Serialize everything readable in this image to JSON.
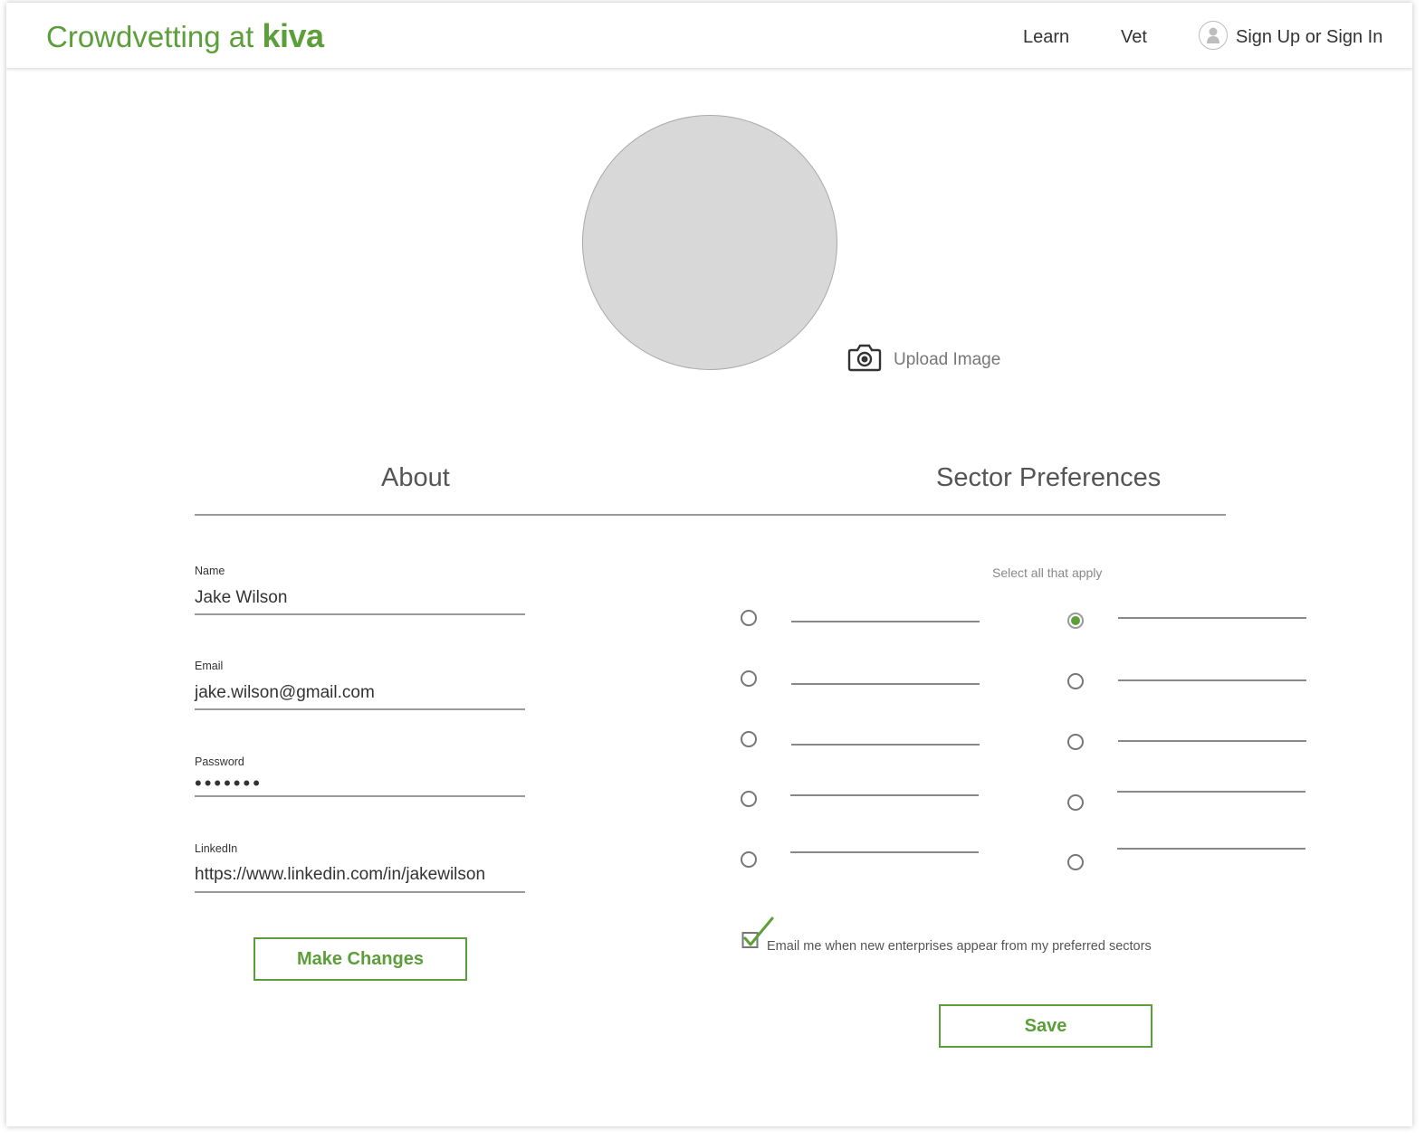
{
  "header": {
    "logo_prefix": "Crowdvetting at",
    "logo_brand": "kiva",
    "nav": {
      "learn": "Learn",
      "vet": "Vet",
      "sign_in": "Sign Up or Sign In"
    }
  },
  "profile": {
    "upload_label": "Upload Image"
  },
  "tabs": {
    "about": "About",
    "sector_preferences": "Sector Preferences"
  },
  "about": {
    "name_label": "Name",
    "name_value": "Jake Wilson",
    "email_label": "Email",
    "email_value": "jake.wilson@gmail.com",
    "password_label": "Password",
    "password_value": "•••••••",
    "linkedin_label": "LinkedIn",
    "linkedin_value": "https://www.linkedin.com/in/jakewilson",
    "make_changes_label": "Make Changes"
  },
  "sectors": {
    "hint": "Select all that apply",
    "left_column_selected": [
      false,
      false,
      false,
      false,
      false
    ],
    "right_column_selected": [
      true,
      false,
      false,
      false,
      false
    ],
    "email_opt_in_label": "Email me when new enterprises appear from my preferred sectors",
    "email_opt_in_checked": true,
    "save_label": "Save"
  },
  "colors": {
    "accent": "#5c9e3a",
    "placeholder_gray": "#d8d8d8"
  }
}
